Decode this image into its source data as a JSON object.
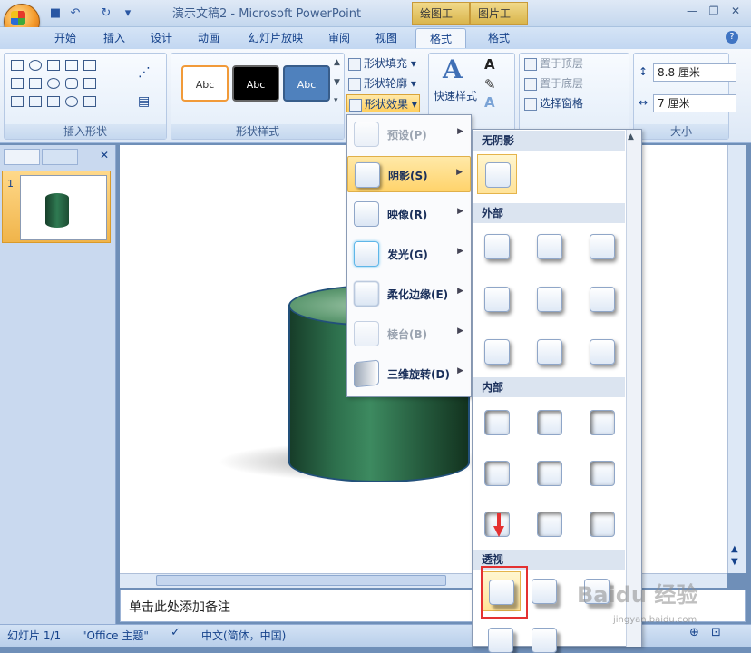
{
  "window": {
    "title": "演示文稿2 - Microsoft PowerPoint",
    "context_tools": [
      "绘图工具",
      "图片工具"
    ]
  },
  "tabs": [
    {
      "label": "开始"
    },
    {
      "label": "插入"
    },
    {
      "label": "设计"
    },
    {
      "label": "动画"
    },
    {
      "label": "幻灯片放映"
    },
    {
      "label": "审阅"
    },
    {
      "label": "视图"
    },
    {
      "label": "格式"
    },
    {
      "label": "格式"
    }
  ],
  "ribbon": {
    "insert_shapes_label": "插入形状",
    "shape_styles_label": "形状样式",
    "style_sample": "Abc",
    "fill": "形状填充",
    "outline": "形状轮廓",
    "effects": "形状效果",
    "quick_styles": "快速样式",
    "bring_front": "置于顶层",
    "send_back": "置于底层",
    "selection_pane": "选择窗格",
    "size_label": "大小",
    "height": "8.8 厘米",
    "width": "7 厘米"
  },
  "effects_menu": {
    "items": [
      {
        "label": "预设(P)",
        "enabled": false
      },
      {
        "label": "阴影(S)",
        "enabled": true,
        "highlighted": true
      },
      {
        "label": "映像(R)",
        "enabled": true
      },
      {
        "label": "发光(G)",
        "enabled": true
      },
      {
        "label": "柔化边缘(E)",
        "enabled": true
      },
      {
        "label": "棱台(B)",
        "enabled": false
      },
      {
        "label": "三维旋转(D)",
        "enabled": true
      }
    ]
  },
  "shadow_gallery": {
    "sections": [
      "无阴影",
      "外部",
      "内部",
      "透视"
    ]
  },
  "slides_panel": {
    "slide_number": "1"
  },
  "notes": {
    "placeholder": "单击此处添加备注"
  },
  "status": {
    "slide_count": "幻灯片 1/1",
    "theme": "\"Office 主题\"",
    "language": "中文(简体，中国)"
  },
  "watermark": {
    "text": "Baidu 经验",
    "sub": "jingyan.baidu.com"
  },
  "colors": {
    "accent": "#15428b",
    "highlight": "#ffd36b",
    "annotation": "#e43131"
  }
}
